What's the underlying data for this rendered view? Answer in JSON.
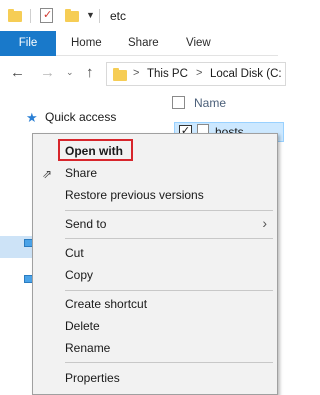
{
  "window": {
    "title": "etc"
  },
  "ribbon": {
    "tabs": [
      "File",
      "Home",
      "Share",
      "View"
    ]
  },
  "address_bar": {
    "crumbs": [
      "This PC",
      "Local Disk (C:"
    ]
  },
  "nav_pane": {
    "quick_access_label": "Quick access"
  },
  "file_list": {
    "column_name": "Name",
    "files": [
      {
        "name": "hosts",
        "checked": true,
        "checkmark": "✓"
      }
    ]
  },
  "context_menu": {
    "open_with": "Open with",
    "share": "Share",
    "restore": "Restore previous versions",
    "send_to": "Send to",
    "cut": "Cut",
    "copy": "Copy",
    "create_shortcut": "Create shortcut",
    "delete": "Delete",
    "rename": "Rename",
    "properties": "Properties"
  },
  "colors": {
    "accent": "#1979ca",
    "highlight_box": "#d7262c",
    "selection": "#cce8ff",
    "folder": "#f6cd55"
  },
  "icons": {
    "quick_access": "star-icon",
    "share": "share-icon",
    "submenu": "chevron-right-icon"
  }
}
